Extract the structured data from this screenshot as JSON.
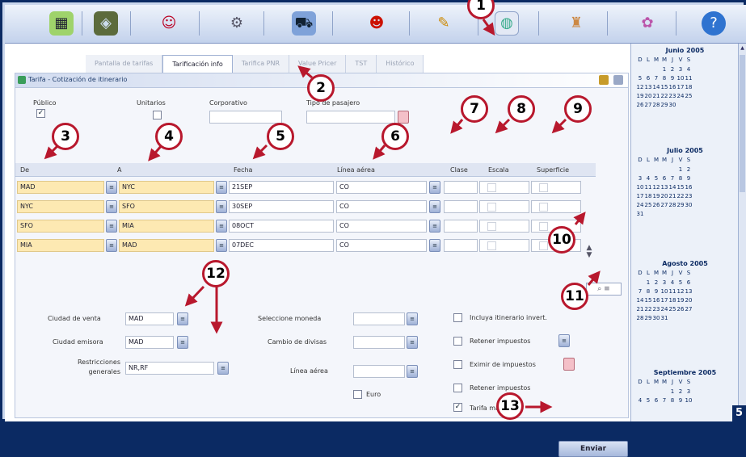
{
  "toolbar": {
    "icons": [
      "map-icon",
      "suitcase-icon",
      "person-icon",
      "shield-icon",
      "car-icon",
      "agent-icon",
      "pencil-icon",
      "globe-icon",
      "bottle-icon",
      "gift-icon",
      "help-icon"
    ]
  },
  "tabs": [
    "Pantalla de tarifas",
    "Tarificación info",
    "Tarifica PNR",
    "Value Pricer",
    "TST",
    "Histórico"
  ],
  "panel": {
    "title": "Tarifa - Cotización de itinerario",
    "publico": "Público",
    "unitario": "Unitarios",
    "corporativo": "Corporativo",
    "tipo_pasajero": "Tipo de pasajero"
  },
  "columns": {
    "de": "De",
    "a": "A",
    "fecha": "Fecha",
    "linea": "Línea aérea",
    "clase": "Clase",
    "escala": "Escala",
    "superficie": "Superficie"
  },
  "rows": [
    {
      "de": "MAD",
      "a": "NYC",
      "fecha": "21SEP",
      "linea": "CO"
    },
    {
      "de": "NYC",
      "a": "SFO",
      "fecha": "30SEP",
      "linea": "CO"
    },
    {
      "de": "SFO",
      "a": "MIA",
      "fecha": "08OCT",
      "linea": "CO"
    },
    {
      "de": "MIA",
      "a": "MAD",
      "fecha": "07DEC",
      "linea": "CO"
    }
  ],
  "form": {
    "ciudad_venta_label": "Ciudad de venta",
    "ciudad_venta": "MAD",
    "ciudad_emision_label": "Ciudad emisora",
    "ciudad_emision": "MAD",
    "restricciones_label": "Restricciones generales",
    "restricciones": "NR,RF",
    "seleccione_moneda": "Seleccione moneda",
    "cambio_divisas": "Cambio de divisas",
    "lineas_aereas": "Línea aérea",
    "euro": "Euro",
    "incluya": "Incluya itinerario invert.",
    "retener1": "Retener impuestos",
    "eximir": "Eximir de impuestos",
    "retener2": "Retener impuestos",
    "tarifa_baja": "Tarifa más baja",
    "enviar": "Enviar"
  },
  "calendar": {
    "weekdays": [
      "D",
      "L",
      "M",
      "M",
      "J",
      "V",
      "S"
    ],
    "months": [
      {
        "name": "Junio 2005",
        "weeks": [
          [
            "",
            "",
            "",
            "1",
            "2",
            "3",
            "4"
          ],
          [
            "5",
            "6",
            "7",
            "8",
            "9",
            "10",
            "11"
          ],
          [
            "12",
            "13",
            "14",
            "15",
            "16",
            "17",
            "18"
          ],
          [
            "19",
            "20",
            "21",
            "22",
            "23",
            "24",
            "25"
          ],
          [
            "26",
            "27",
            "28",
            "29",
            "30",
            "",
            ""
          ]
        ]
      },
      {
        "name": "Julio 2005",
        "weeks": [
          [
            "",
            "",
            "",
            "",
            "",
            "1",
            "2"
          ],
          [
            "3",
            "4",
            "5",
            "6",
            "7",
            "8",
            "9"
          ],
          [
            "10",
            "11",
            "12",
            "13",
            "14",
            "15",
            "16"
          ],
          [
            "17",
            "18",
            "19",
            "20",
            "21",
            "22",
            "23"
          ],
          [
            "24",
            "25",
            "26",
            "27",
            "28",
            "29",
            "30"
          ],
          [
            "31",
            "",
            "",
            "",
            "",
            "",
            ""
          ]
        ]
      },
      {
        "name": "Agosto 2005",
        "weeks": [
          [
            "",
            "1",
            "2",
            "3",
            "4",
            "5",
            "6"
          ],
          [
            "7",
            "8",
            "9",
            "10",
            "11",
            "12",
            "13"
          ],
          [
            "14",
            "15",
            "16",
            "17",
            "18",
            "19",
            "20"
          ],
          [
            "21",
            "22",
            "23",
            "24",
            "25",
            "26",
            "27"
          ],
          [
            "28",
            "29",
            "30",
            "31",
            "",
            "",
            ""
          ]
        ]
      },
      {
        "name": "Septiembre 2005",
        "weeks": [
          [
            "",
            "",
            "",
            "",
            "1",
            "2",
            "3"
          ],
          [
            "4",
            "5",
            "6",
            "7",
            "8",
            "9",
            "10"
          ]
        ]
      }
    ]
  },
  "callouts": [
    "1",
    "2",
    "3",
    "4",
    "5",
    "6",
    "7",
    "8",
    "9",
    "10",
    "11",
    "12",
    "13"
  ],
  "page_number": "5",
  "colors": {
    "frame": "#0b2a63",
    "callout_border": "#b8182d",
    "highlight": "#fde9b2"
  }
}
